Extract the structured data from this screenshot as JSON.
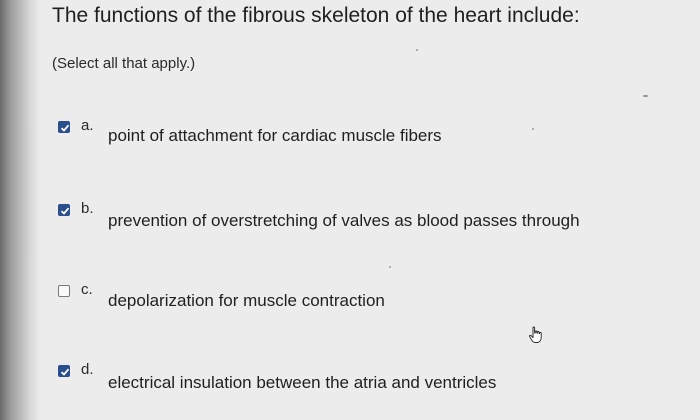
{
  "question": {
    "title": "The functions of the fibrous skeleton of the heart include:",
    "instruction": "(Select all that apply.)"
  },
  "options": [
    {
      "letter": "a.",
      "text": "point of attachment for cardiac muscle fibers",
      "checked": true
    },
    {
      "letter": "b.",
      "text": "prevention of overstretching of valves as blood passes through",
      "checked": true
    },
    {
      "letter": "c.",
      "text": "depolarization for muscle contraction",
      "checked": false
    },
    {
      "letter": "d.",
      "text": "electrical insulation between the atria and ventricles",
      "checked": true
    }
  ],
  "icons": {
    "checkbox_checked": "checkmark-icon",
    "pointer": "hand-pointer-icon"
  },
  "colors": {
    "checkbox_checked": "#2b4e8c",
    "background": "#ececec"
  }
}
